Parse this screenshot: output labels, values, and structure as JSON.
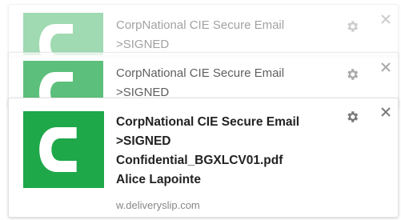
{
  "notifications": [
    {
      "app_name": "CorpNational CIE Secure Email",
      "message": ">SIGNED",
      "status": "background"
    },
    {
      "app_name": "CorpNational CIE Secure Email",
      "message": ">SIGNED",
      "status": "background"
    },
    {
      "app_name": "CorpNational CIE Secure Email",
      "message": ">SIGNED",
      "attachment": "Confidential_BGXLCV01.pdf",
      "sender": "Alice Lapointe",
      "source": "w.deliveryslip.com",
      "status": "active"
    }
  ],
  "icons": {
    "logo": "green-c-logo",
    "settings": "gear-icon",
    "dismiss": "close-icon"
  },
  "colors": {
    "brand_green": "#1ea84a",
    "icon_gray": "#8a8a8a",
    "source_text": "#888888"
  }
}
